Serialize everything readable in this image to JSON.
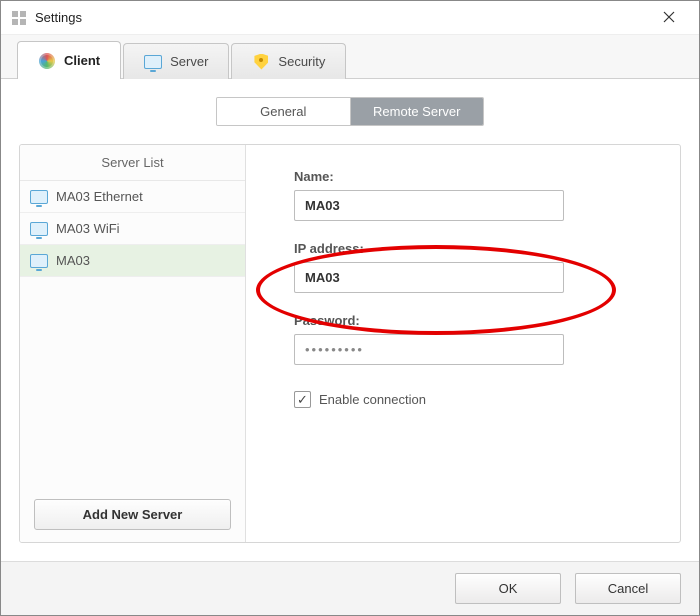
{
  "window": {
    "title": "Settings"
  },
  "tabs": {
    "client": "Client",
    "server": "Server",
    "security": "Security"
  },
  "subtabs": {
    "general": "General",
    "remote": "Remote Server"
  },
  "left": {
    "header": "Server List",
    "add_button": "Add New Server",
    "items": [
      {
        "label": "MA03 Ethernet"
      },
      {
        "label": "MA03 WiFi"
      },
      {
        "label": "MA03"
      }
    ]
  },
  "form": {
    "name_label": "Name:",
    "name_value": "MA03",
    "ip_label": "IP address:",
    "ip_value": "MA03",
    "pw_label": "Password:",
    "pw_value": "•••••••••",
    "enable_label": "Enable connection",
    "enable_checked": "✓"
  },
  "footer": {
    "ok": "OK",
    "cancel": "Cancel"
  }
}
